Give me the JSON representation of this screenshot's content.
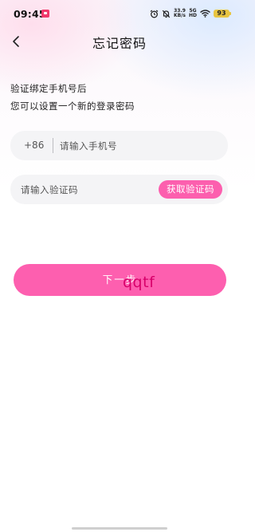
{
  "status_bar": {
    "time": "09:45",
    "net_speed_value": "33.9",
    "net_speed_unit": "KB/s",
    "network_gen": "5G",
    "network_gen_sub": "HD",
    "battery": "93"
  },
  "header": {
    "title": "忘记密码"
  },
  "description": {
    "line1": "验证绑定手机号后",
    "line2": "您可以设置一个新的登录密码"
  },
  "phone_field": {
    "country_code": "+86",
    "placeholder": "请输入手机号",
    "value": ""
  },
  "code_field": {
    "placeholder": "请输入验证码",
    "value": "",
    "get_code_label": "获取验证码"
  },
  "next_button": {
    "label": "下一步"
  },
  "watermark": {
    "text": "qqtf"
  },
  "colors": {
    "accent": "#fd5faf",
    "field_bg": "#f4f4f6"
  },
  "icons": {
    "back": "chevron-left-icon",
    "alarm": "alarm-icon",
    "mute": "bell-off-icon",
    "wifi": "wifi-icon",
    "notification": "app-notification-icon"
  }
}
